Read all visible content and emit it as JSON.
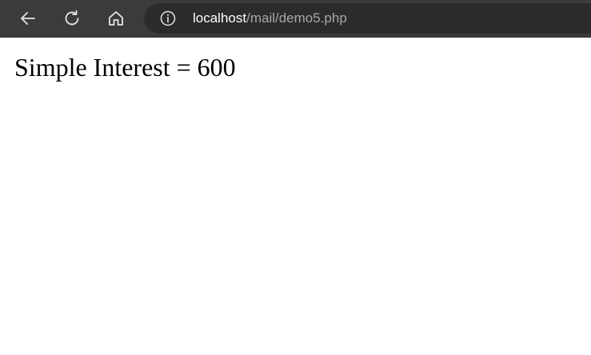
{
  "browser": {
    "toolbar": {
      "back_icon": "back-arrow-icon",
      "refresh_icon": "refresh-icon",
      "home_icon": "home-icon"
    },
    "address_bar": {
      "info_icon": "info-icon",
      "host": "localhost",
      "path": "/mail/demo5.php"
    },
    "colors": {
      "toolbar_bg": "#3b3b3b",
      "address_bg": "#2b2b2b",
      "host_text": "#ffffff",
      "path_text": "#a6a6a6"
    }
  },
  "page": {
    "result_text": "Simple Interest = 600"
  }
}
